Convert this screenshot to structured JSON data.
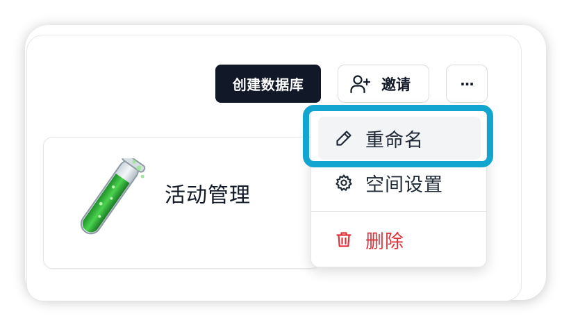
{
  "toolbar": {
    "create_db_label": "创建数据库",
    "invite_label": "邀请",
    "more_label": "···",
    "invite_icon": "user-plus-icon"
  },
  "database": {
    "name": "活动管理",
    "icon": "test-tube-icon"
  },
  "menu": {
    "items": [
      {
        "label": "重命名",
        "icon": "pencil-icon",
        "state": "hovered"
      },
      {
        "label": "空间设置",
        "icon": "gear-icon"
      },
      {
        "label": "删除",
        "icon": "trash-icon",
        "danger": true
      }
    ]
  },
  "colors": {
    "primary_dark": "#111827",
    "highlight": "#12a5cf",
    "danger": "#e0323a",
    "hover_bg": "#f3f4f6"
  }
}
